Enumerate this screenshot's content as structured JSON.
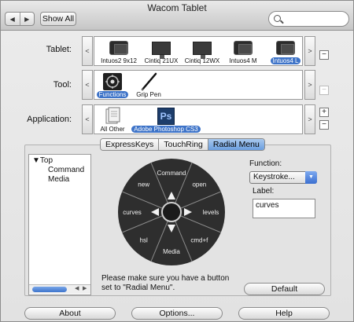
{
  "window": {
    "title": "Wacom Tablet"
  },
  "toolbar": {
    "show_all": "Show All",
    "search_placeholder": "",
    "search_value": ""
  },
  "tablet_row": {
    "label": "Tablet:",
    "items": [
      {
        "name": "Intuos2 9x12",
        "kind": "tablet",
        "selected": false
      },
      {
        "name": "Cintiq 21UX",
        "kind": "monitor",
        "selected": false
      },
      {
        "name": "Cintiq 12WX",
        "kind": "monitor",
        "selected": false
      },
      {
        "name": "Intuos4 M",
        "kind": "tablet",
        "selected": false
      },
      {
        "name": "Intuos4 L",
        "kind": "tablet",
        "selected": true
      }
    ]
  },
  "tool_row": {
    "label": "Tool:",
    "items": [
      {
        "name": "Functions",
        "selected": true
      },
      {
        "name": "Grip Pen",
        "selected": false
      }
    ]
  },
  "application_row": {
    "label": "Application:",
    "items": [
      {
        "name": "All Other",
        "selected": false
      },
      {
        "name": "Adobe Photoshop CS3",
        "icon_text": "Ps",
        "selected": true
      }
    ]
  },
  "tabs": [
    {
      "label": "ExpressKeys",
      "active": false
    },
    {
      "label": "TouchRing",
      "active": false
    },
    {
      "label": "Radial Menu",
      "active": true
    }
  ],
  "tree": {
    "root": "Top",
    "children": [
      "Command",
      "Media"
    ]
  },
  "radial_menu": {
    "segments": [
      "Command",
      "open",
      "levels",
      "cmd+f",
      "Media",
      "hsl",
      "curves",
      "new"
    ]
  },
  "note": "Please make sure you have a button set to \"Radial Menu\".",
  "function_panel": {
    "function_label": "Function:",
    "function_value": "Keystroke...",
    "label_label": "Label:",
    "label_value": "curves",
    "default_button": "Default"
  },
  "footer": {
    "about": "About",
    "options": "Options...",
    "help": "Help"
  },
  "colors": {
    "selection": "#3d73c8",
    "wheel": "#2e2e2e",
    "photoshop": "#1d3d6b"
  }
}
